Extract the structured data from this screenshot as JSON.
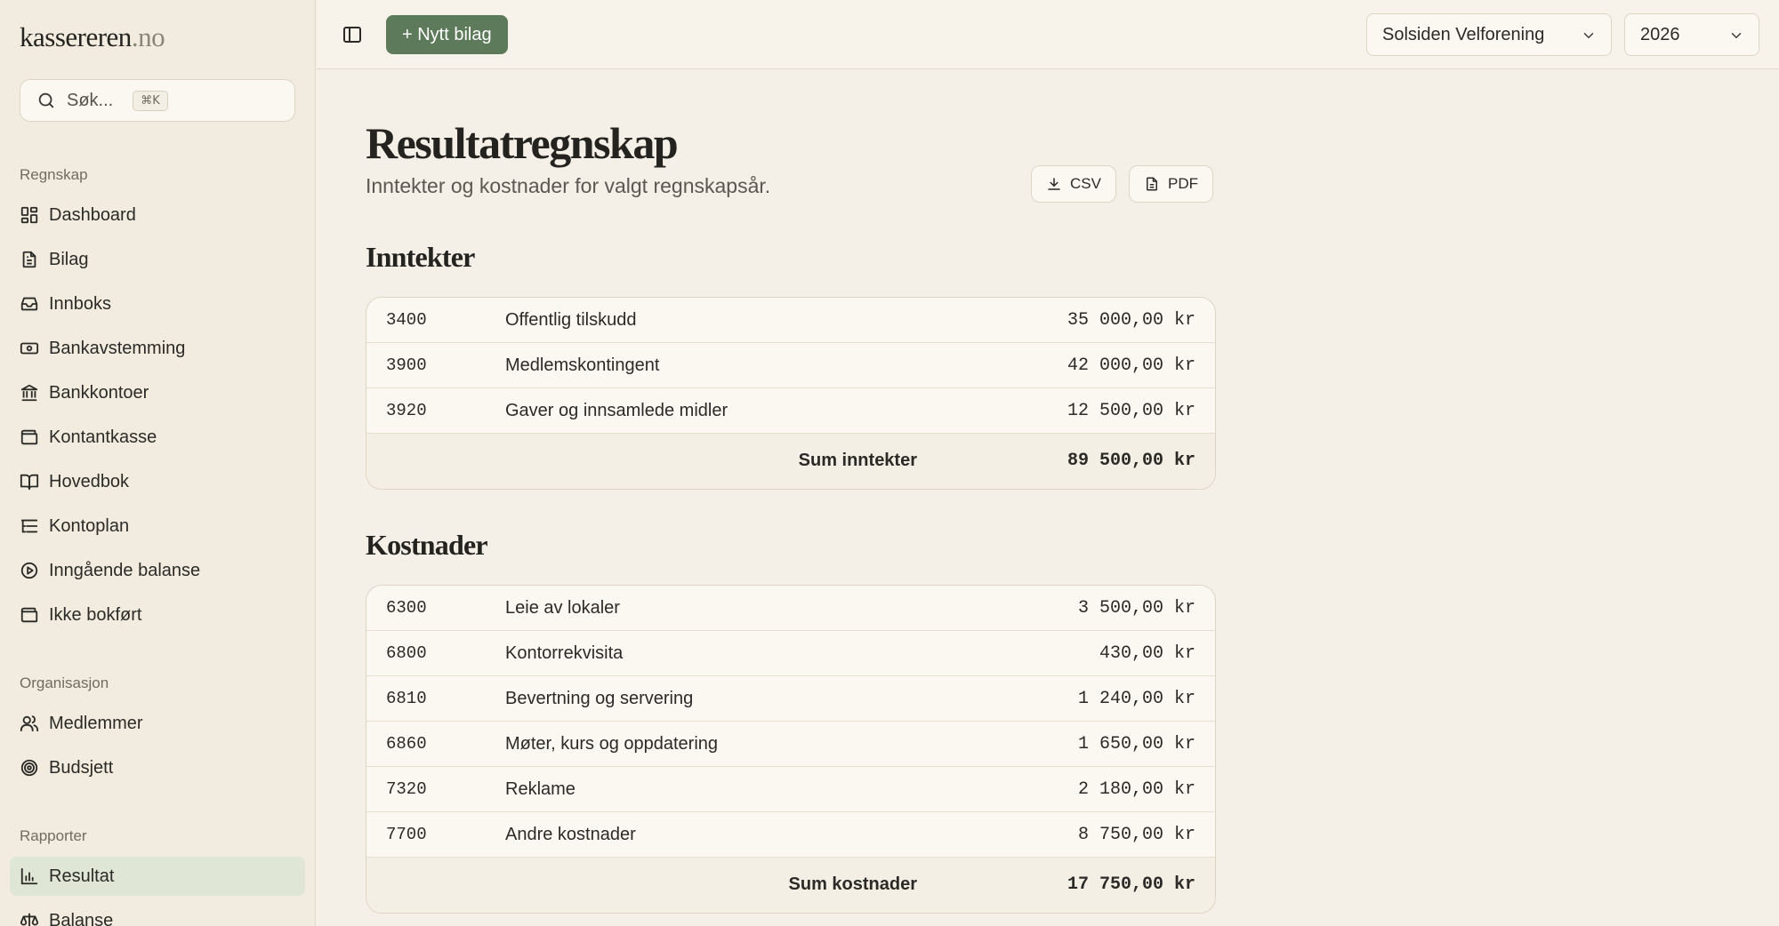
{
  "brand": {
    "name": "kassereren",
    "tld": ".no"
  },
  "search": {
    "placeholder": "Søk...",
    "shortcut": "⌘K"
  },
  "sidebar": {
    "sections": [
      {
        "label": "Regnskap",
        "items": [
          {
            "label": "Dashboard",
            "icon": "dashboard-icon"
          },
          {
            "label": "Bilag",
            "icon": "document-icon"
          },
          {
            "label": "Innboks",
            "icon": "inbox-icon"
          },
          {
            "label": "Bankavstemming",
            "icon": "banknote-icon"
          },
          {
            "label": "Bankkontoer",
            "icon": "bank-icon"
          },
          {
            "label": "Kontantkasse",
            "icon": "wallet-icon"
          },
          {
            "label": "Hovedbok",
            "icon": "book-icon"
          },
          {
            "label": "Kontoplan",
            "icon": "list-tree-icon"
          },
          {
            "label": "Inngående balanse",
            "icon": "play-circle-icon"
          },
          {
            "label": "Ikke bokført",
            "icon": "wallet-icon"
          }
        ]
      },
      {
        "label": "Organisasjon",
        "items": [
          {
            "label": "Medlemmer",
            "icon": "users-icon"
          },
          {
            "label": "Budsjett",
            "icon": "target-icon"
          }
        ]
      },
      {
        "label": "Rapporter",
        "items": [
          {
            "label": "Resultat",
            "icon": "bar-chart-icon",
            "active": true
          },
          {
            "label": "Balanse",
            "icon": "scale-icon"
          }
        ]
      }
    ]
  },
  "topbar": {
    "new_button": "+ Nytt bilag",
    "org_select": "Solsiden Velforening",
    "year_select": "2026"
  },
  "page": {
    "title": "Resultatregnskap",
    "subtitle": "Inntekter og kostnader for valgt regnskapsår.",
    "export_csv": "CSV",
    "export_pdf": "PDF"
  },
  "income": {
    "heading": "Inntekter",
    "rows": [
      {
        "code": "3400",
        "name": "Offentlig tilskudd",
        "amount": "35 000,00 kr"
      },
      {
        "code": "3900",
        "name": "Medlemskontingent",
        "amount": "42 000,00 kr"
      },
      {
        "code": "3920",
        "name": "Gaver og innsamlede midler",
        "amount": "12 500,00 kr"
      }
    ],
    "sum_label": "Sum inntekter",
    "sum_amount": "89 500,00 kr"
  },
  "costs": {
    "heading": "Kostnader",
    "rows": [
      {
        "code": "6300",
        "name": "Leie av lokaler",
        "amount": "3 500,00 kr"
      },
      {
        "code": "6800",
        "name": "Kontorrekvisita",
        "amount": "430,00 kr"
      },
      {
        "code": "6810",
        "name": "Bevertning og servering",
        "amount": "1 240,00 kr"
      },
      {
        "code": "6860",
        "name": "Møter, kurs og oppdatering",
        "amount": "1 650,00 kr"
      },
      {
        "code": "7320",
        "name": "Reklame",
        "amount": "2 180,00 kr"
      },
      {
        "code": "7700",
        "name": "Andre kostnader",
        "amount": "8 750,00 kr"
      }
    ],
    "sum_label": "Sum kostnader",
    "sum_amount": "17 750,00 kr"
  },
  "colors": {
    "accent": "#5d7a5a",
    "active_nav": "#dfe6d6",
    "background": "#f4f0e7"
  }
}
